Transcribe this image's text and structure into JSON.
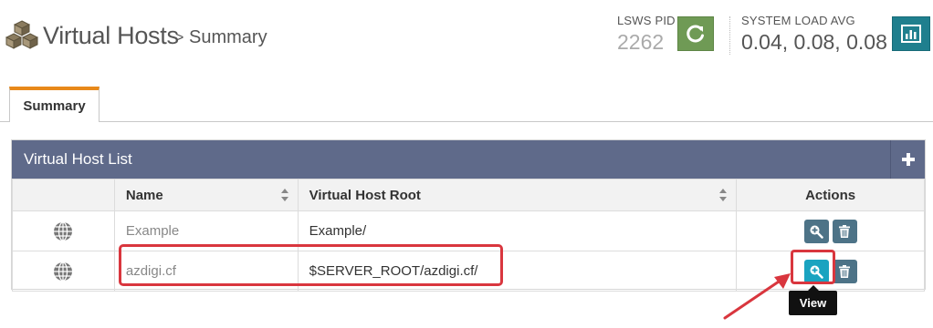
{
  "header": {
    "title": "Virtual Hosts",
    "separator": ">",
    "breadcrumb": "Summary",
    "pid_label": "LSWS PID",
    "pid_value": "2262",
    "load_label": "SYSTEM LOAD AVG",
    "load_value": "0.04, 0.08, 0.08"
  },
  "tabs": [
    {
      "label": "Summary",
      "active": true
    }
  ],
  "panel": {
    "title": "Virtual Host List",
    "add_icon": "plus-icon"
  },
  "table": {
    "columns": [
      "",
      "Name",
      "Virtual Host Root",
      "Actions"
    ],
    "rows": [
      {
        "name": "Example",
        "root": "Example/"
      },
      {
        "name": "azdigi.cf",
        "root": "$SERVER_ROOT/azdigi.cf/"
      }
    ]
  },
  "tooltip": "View",
  "colors": {
    "accent_tab": "#e8891a",
    "panel_header": "#5f6a8a",
    "restart_button": "#6f9a55",
    "chart_button": "#1f7f8e",
    "action_button": "#4d7387",
    "action_button_active": "#1aa3c0",
    "annotation": "#d9363e"
  }
}
